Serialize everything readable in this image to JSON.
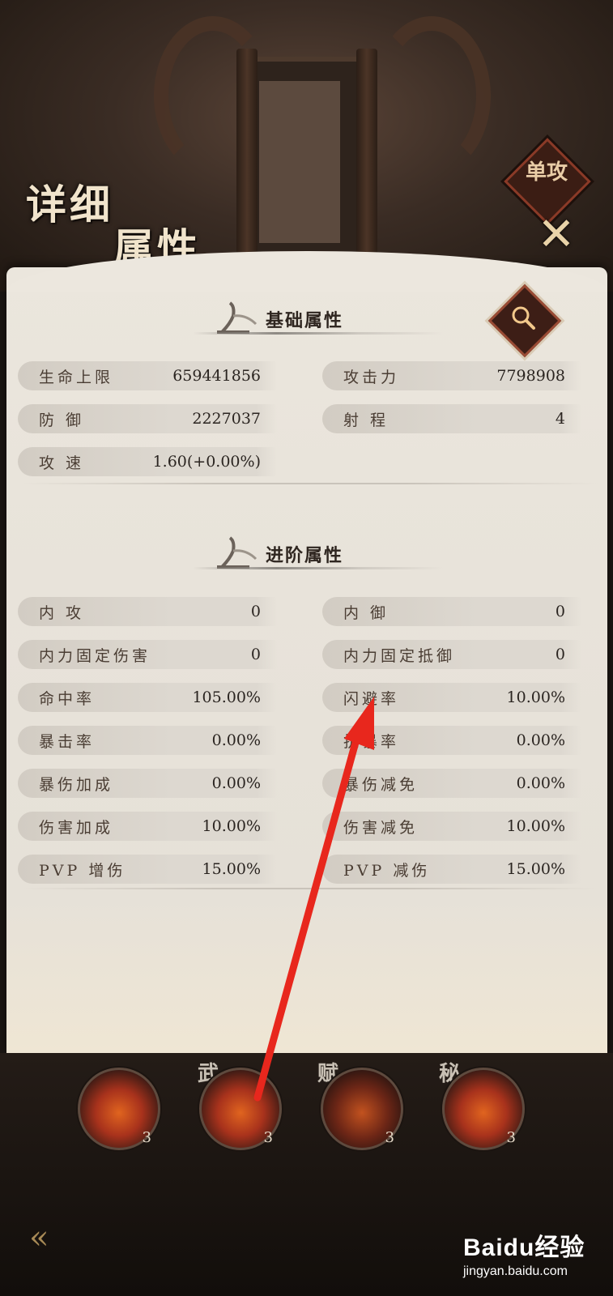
{
  "header": {
    "title_line1": "详细",
    "title_line2": "属性",
    "tab_stamp": "单攻",
    "close_label": "✕"
  },
  "basic": {
    "title": "基础属性",
    "left": [
      {
        "label": "生命上限",
        "value": "659441856"
      },
      {
        "label": "防  御",
        "value": "2227037"
      },
      {
        "label": "攻  速",
        "value": "1.60(+0.00%)"
      }
    ],
    "right": [
      {
        "label": "攻击力",
        "value": "7798908"
      },
      {
        "label": "射  程",
        "value": "4"
      }
    ]
  },
  "advanced": {
    "title": "进阶属性",
    "left": [
      {
        "label": "内  攻",
        "value": "0"
      },
      {
        "label": "内力固定伤害",
        "value": "0"
      },
      {
        "label": "命中率",
        "value": "105.00%"
      },
      {
        "label": "暴击率",
        "value": "0.00%"
      },
      {
        "label": "暴伤加成",
        "value": "0.00%"
      },
      {
        "label": "伤害加成",
        "value": "10.00%"
      },
      {
        "label": "PVP 增伤",
        "value": "15.00%"
      }
    ],
    "right": [
      {
        "label": "内  御",
        "value": "0"
      },
      {
        "label": "内力固定抵御",
        "value": "0"
      },
      {
        "label": "闪避率",
        "value": "10.00%"
      },
      {
        "label": "抗暴率",
        "value": "0.00%"
      },
      {
        "label": "暴伤减免",
        "value": "0.00%"
      },
      {
        "label": "伤害减免",
        "value": "10.00%"
      },
      {
        "label": "PVP 减伤",
        "value": "15.00%"
      }
    ]
  },
  "skills": [
    {
      "tag": "",
      "level": "3"
    },
    {
      "tag": "武",
      "level": "3"
    },
    {
      "tag": "赋",
      "level": "3"
    },
    {
      "tag": "秘",
      "level": "3"
    }
  ],
  "watermark": {
    "brand": "Baidu经验",
    "url": "jingyan.baidu.com"
  },
  "colors": {
    "panel_bg": "#e8e3da",
    "row_bg": "#d8d2c9",
    "stamp_red": "#3d1e16",
    "annotation_arrow": "#e8271d"
  }
}
